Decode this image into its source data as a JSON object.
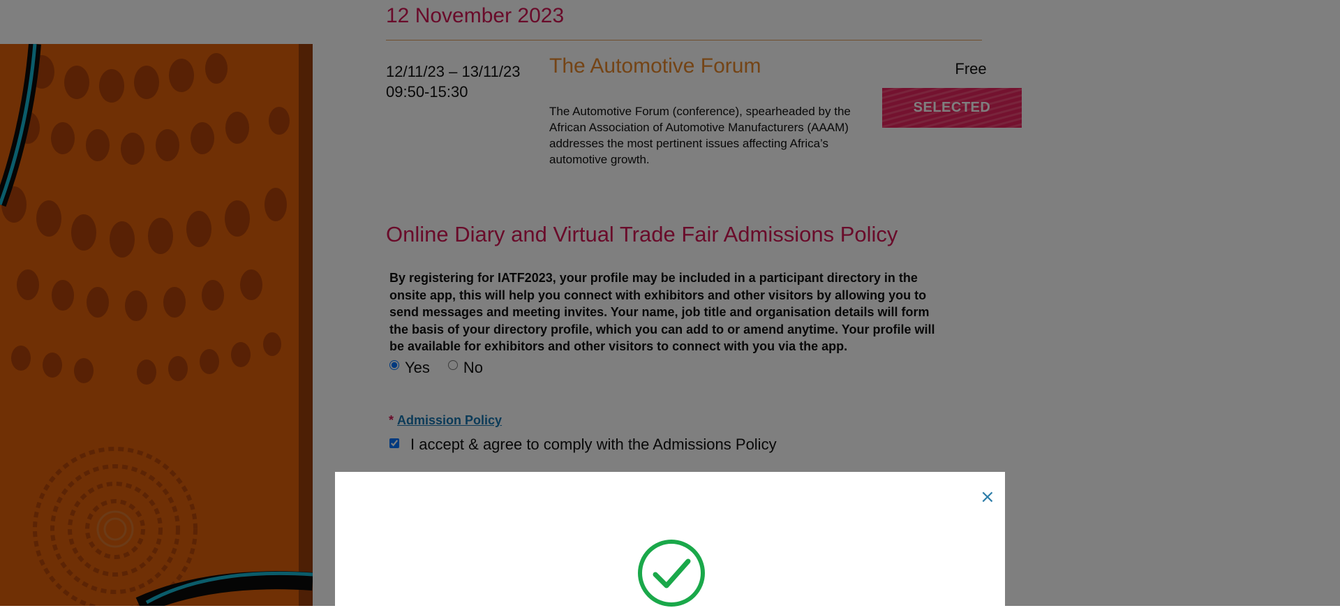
{
  "event": {
    "date_heading": "12 November 2023",
    "session": {
      "date_range": "12/11/23 – 13/11/23",
      "time_range": "09:50-15:30",
      "title": "The Automotive Forum",
      "description": "The Automotive Forum (conference), spearheaded by the African Association of Automotive Manufacturers (AAAM) addresses the most pertinent issues affecting Africa’s automotive growth.",
      "price": "Free",
      "button_label": "SELECTED"
    }
  },
  "policy": {
    "heading": "Online Diary and Virtual Trade Fair Admissions Policy",
    "text": "By registering for IATF2023, your profile may be included in a participant directory in the onsite app, this will help you connect with exhibitors and other visitors by allowing you to send messages and meeting invites. Your name, job title and organisation details will form the basis of your directory profile, which you can add to or amend anytime. Your profile will be available for exhibitors and other visitors to connect with you via the app.",
    "options": {
      "yes": "Yes",
      "no": "No",
      "selected": "Yes"
    },
    "required_marker": "*",
    "admission_link": "Admission Policy",
    "accept_label": "I accept & agree to comply with the Admissions Policy",
    "accept_checked": true
  },
  "modal": {
    "close_symbol": "×",
    "status_icon": "check-circle-icon"
  },
  "colors": {
    "heading_accent": "#d31654",
    "title_accent": "#e8892c",
    "link": "#1976b0",
    "success": "#1aa84a",
    "banner_orange": "#e0600a"
  }
}
